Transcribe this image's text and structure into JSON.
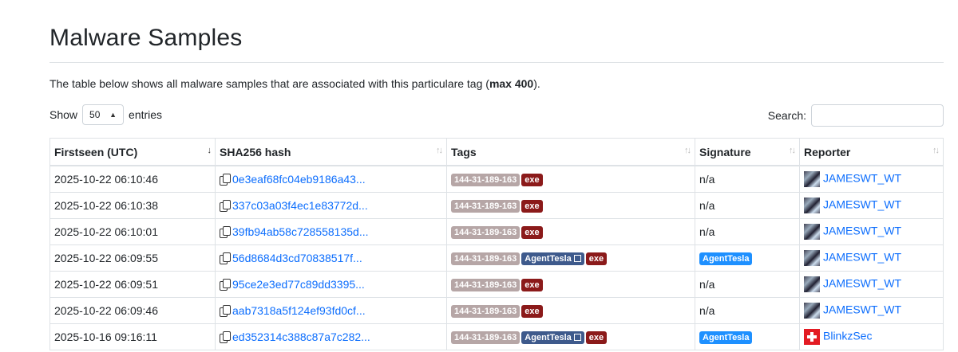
{
  "page": {
    "title": "Malware Samples",
    "intro_prefix": "The table below shows all malware samples that are associated with this particulare tag (",
    "intro_bold": "max 400",
    "intro_suffix": ")."
  },
  "controls": {
    "show_label": "Show",
    "entries_value": "50",
    "entries_label": "entries",
    "search_label": "Search:",
    "search_value": ""
  },
  "table": {
    "headers": [
      "Firstseen (UTC)",
      "SHA256 hash",
      "Tags",
      "Signature",
      "Reporter"
    ],
    "rows": [
      {
        "firstseen": "2025-10-22 06:10:46",
        "hash": "0e3eaf68fc04eb9186a43...",
        "tags": [
          "144-31-189-163",
          "exe"
        ],
        "family": null,
        "signature": "n/a",
        "reporter": "JAMESWT_WT",
        "avatar": "jameswt"
      },
      {
        "firstseen": "2025-10-22 06:10:38",
        "hash": "337c03a03f4ec1e83772d...",
        "tags": [
          "144-31-189-163",
          "exe"
        ],
        "family": null,
        "signature": "n/a",
        "reporter": "JAMESWT_WT",
        "avatar": "jameswt"
      },
      {
        "firstseen": "2025-10-22 06:10:01",
        "hash": "39fb94ab58c728558135d...",
        "tags": [
          "144-31-189-163",
          "exe"
        ],
        "family": null,
        "signature": "n/a",
        "reporter": "JAMESWT_WT",
        "avatar": "jameswt"
      },
      {
        "firstseen": "2025-10-22 06:09:55",
        "hash": "56d8684d3cd70838517f...",
        "tags": [
          "144-31-189-163",
          "exe"
        ],
        "family": "AgentTesla",
        "signature": "AgentTesla",
        "reporter": "JAMESWT_WT",
        "avatar": "jameswt"
      },
      {
        "firstseen": "2025-10-22 06:09:51",
        "hash": "95ce2e3ed77c89dd3395...",
        "tags": [
          "144-31-189-163",
          "exe"
        ],
        "family": null,
        "signature": "n/a",
        "reporter": "JAMESWT_WT",
        "avatar": "jameswt"
      },
      {
        "firstseen": "2025-10-22 06:09:46",
        "hash": "aab7318a5f124ef93fd0cf...",
        "tags": [
          "144-31-189-163",
          "exe"
        ],
        "family": null,
        "signature": "n/a",
        "reporter": "JAMESWT_WT",
        "avatar": "jameswt"
      },
      {
        "firstseen": "2025-10-16 09:16:11",
        "hash": "ed352314c388c87a7c282...",
        "tags": [
          "144-31-189-163",
          "exe"
        ],
        "family": "AgentTesla",
        "signature": "AgentTesla",
        "reporter": "BlinkzSec",
        "avatar": "swiss-flag"
      }
    ]
  },
  "colors": {
    "link": "#0d6efd",
    "tag_ip": "#b6a6a6",
    "tag_exe": "#8b1a1a",
    "tag_family": "#3e5a8c",
    "signature_badge": "#1e90ff"
  }
}
